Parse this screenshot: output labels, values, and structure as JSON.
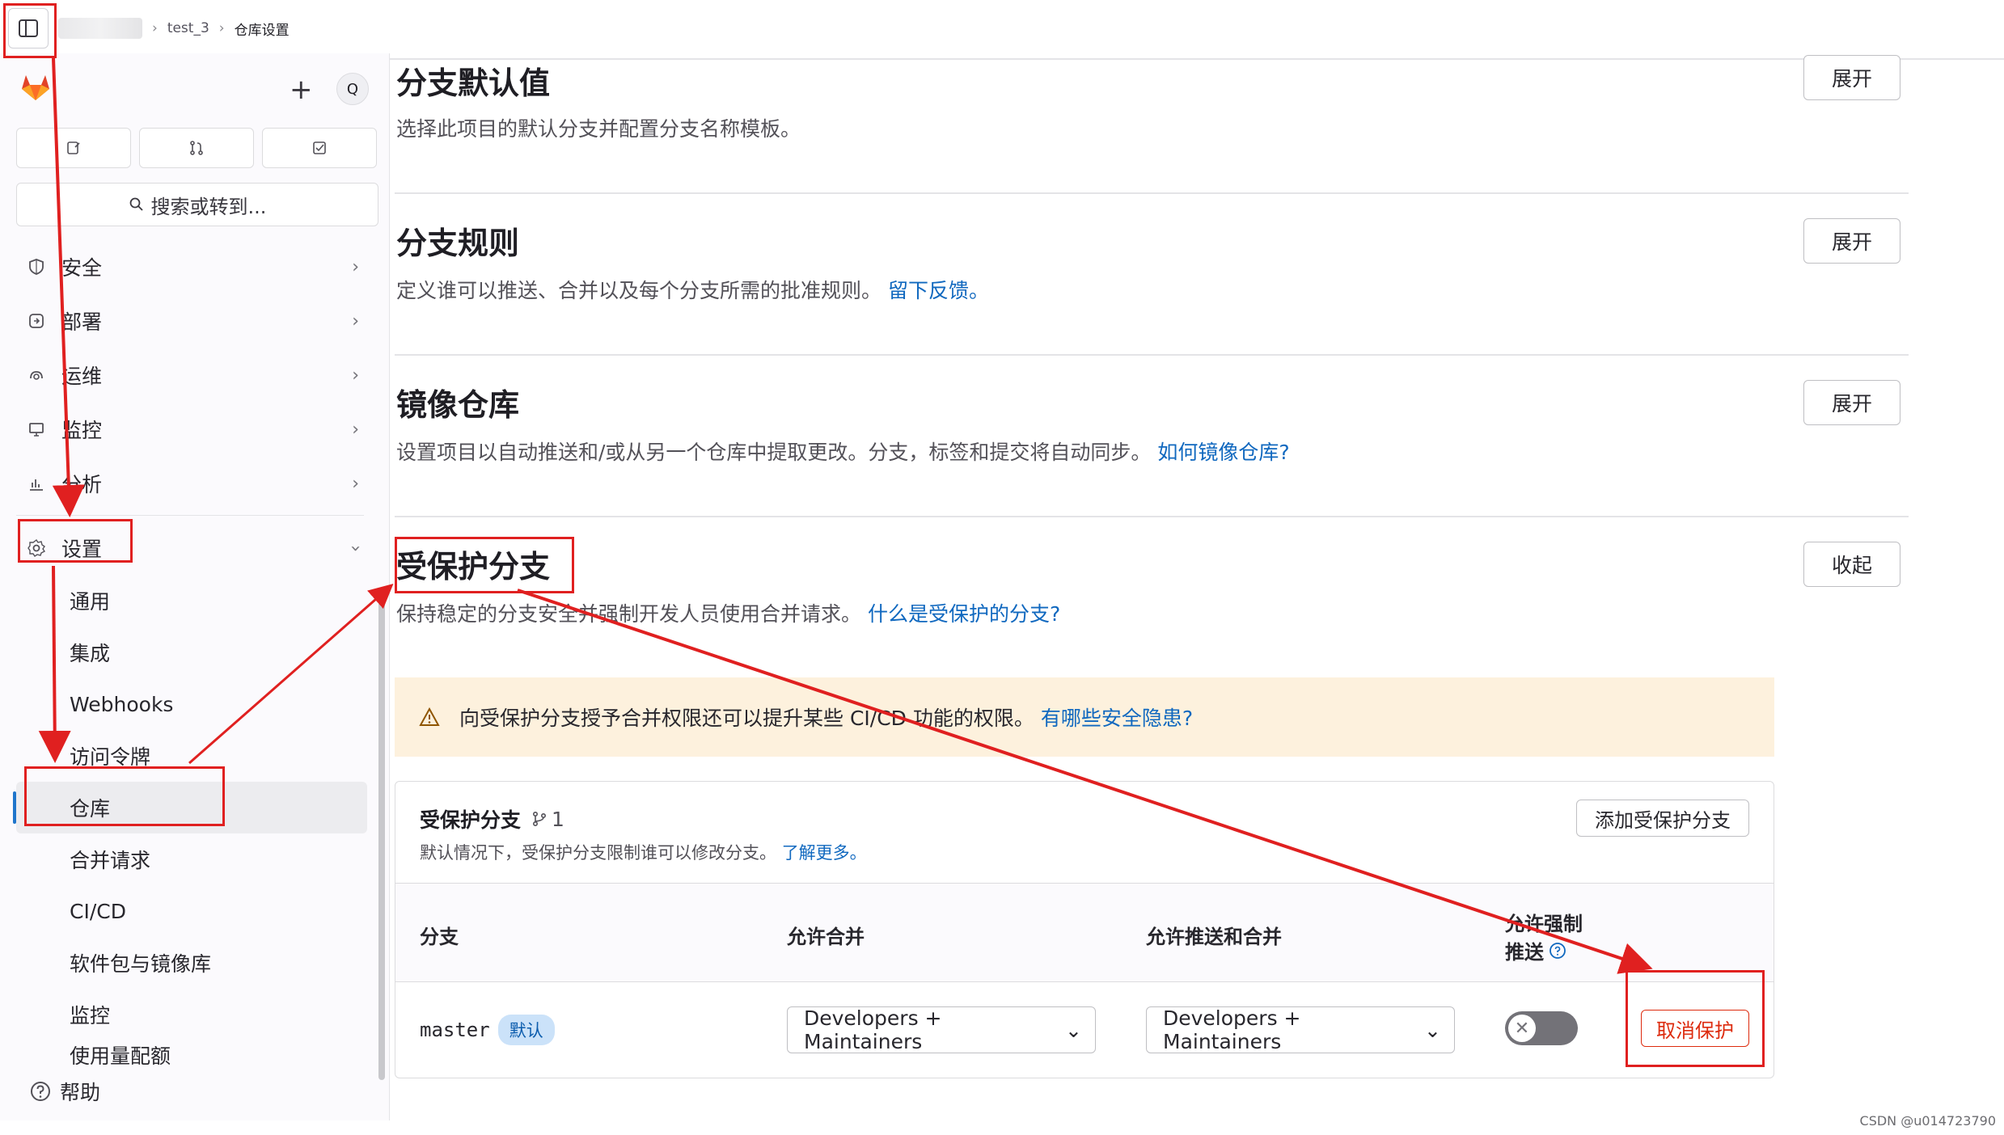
{
  "breadcrumb": {
    "project": "test_3",
    "current": "仓库设置"
  },
  "sidebar": {
    "avatar_letter": "Q",
    "plus": "+",
    "search_label": "搜索或转到...",
    "nav": [
      {
        "label": "安全",
        "icon": "shield-icon"
      },
      {
        "label": "部署",
        "icon": "deploy-icon"
      },
      {
        "label": "运维",
        "icon": "operate-icon"
      },
      {
        "label": "监控",
        "icon": "monitor-icon"
      },
      {
        "label": "分析",
        "icon": "chart-icon"
      }
    ],
    "settings_label": "设置",
    "settings_sub": [
      "通用",
      "集成",
      "Webhooks",
      "访问令牌",
      "仓库",
      "合并请求",
      "CI/CD",
      "软件包与镜像库",
      "监控",
      "使用量配额"
    ],
    "help_label": "帮助"
  },
  "sections": {
    "default_branch": {
      "title": "分支默认值",
      "desc": "选择此项目的默认分支并配置分支名称模板。",
      "button": "展开"
    },
    "branch_rules": {
      "title": "分支规则",
      "desc": "定义谁可以推送、合并以及每个分支所需的批准规则。",
      "link": "留下反馈。",
      "button": "展开"
    },
    "mirror": {
      "title": "镜像仓库",
      "desc": "设置项目以自动推送和/或从另一个仓库中提取更改。分支，标签和提交将自动同步。",
      "link": "如何镜像仓库?",
      "button": "展开"
    },
    "protected": {
      "title": "受保护分支",
      "desc": "保持稳定的分支安全并强制开发人员使用合并请求。",
      "link": "什么是受保护的分支?",
      "button": "收起"
    }
  },
  "alert": {
    "text": "向受保护分支授予合并权限还可以提升某些 CI/CD 功能的权限。",
    "link": "有哪些安全隐患?"
  },
  "protected_card": {
    "title": "受保护分支",
    "count": "1",
    "desc": "默认情况下，受保护分支限制谁可以修改分支。",
    "desc_link": "了解更多。",
    "add_button": "添加受保护分支",
    "columns": [
      "分支",
      "允许合并",
      "允许推送和合并",
      "允许强制",
      "推送"
    ],
    "row": {
      "branch": "master",
      "badge": "默认",
      "merge": "Developers + Maintainers",
      "push": "Developers + Maintainers",
      "force_push": false,
      "unprotect": "取消保护"
    }
  },
  "watermark": "CSDN @u014723790",
  "colors": {
    "annotation": "#e02020",
    "link": "#1068bf",
    "alert_bg": "#fdf1dd",
    "danger": "#dd2b0e"
  }
}
